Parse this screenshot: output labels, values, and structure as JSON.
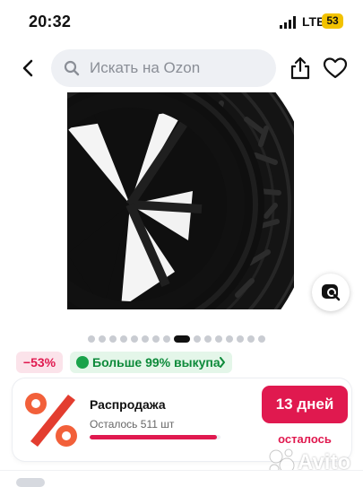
{
  "status_bar": {
    "time": "20:32",
    "network": "LTE",
    "battery": "53"
  },
  "header": {
    "search_placeholder": "Искать на Ozon"
  },
  "gallery": {
    "dots_total": 16,
    "active_index": 8
  },
  "badges": {
    "discount": "−53%",
    "buyout": "Больше 99% выкупа"
  },
  "sale": {
    "title": "Распродажа",
    "remaining": "Осталось 511 шт",
    "progress": 0.97,
    "timer": "13 дней",
    "timer_sub": "осталось"
  },
  "watermark": {
    "text": "Avito"
  },
  "next_section": {
    "peek": ""
  },
  "colors": {
    "accent": "#e0194f",
    "green": "#19a34a",
    "battery": "#f2c200"
  }
}
